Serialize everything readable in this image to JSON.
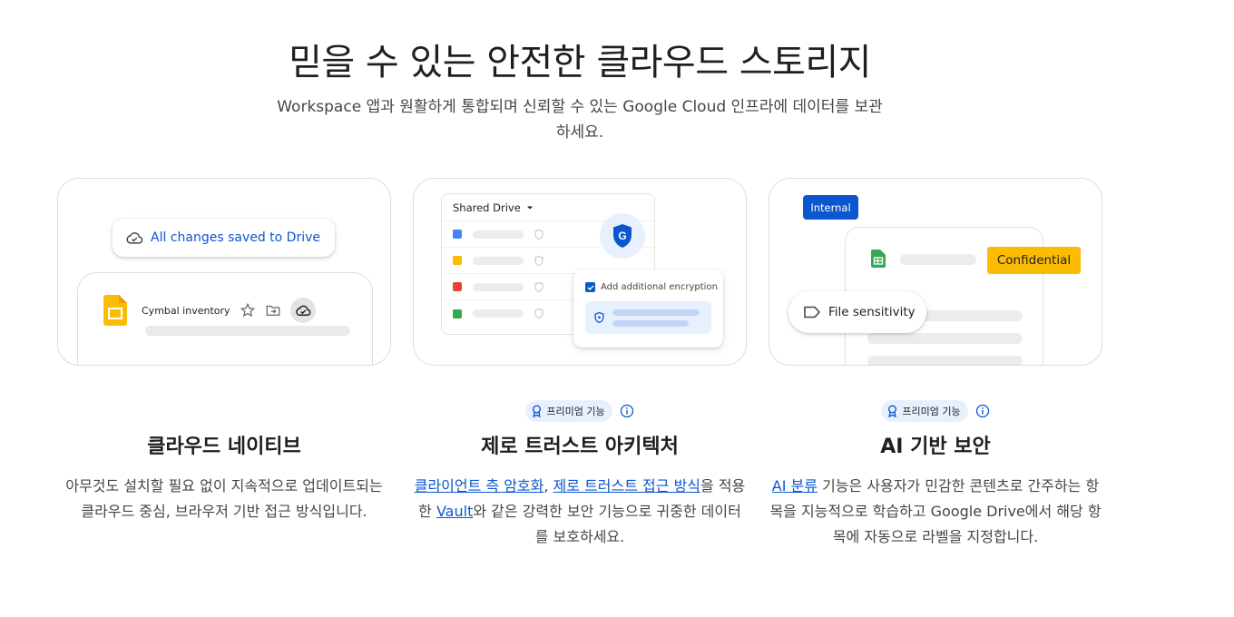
{
  "hero": {
    "title": "믿을 수 있는 안전한 클라우드 스토리지",
    "subtitle": "Workspace 앱과 원활하게 통합되며 신뢰할 수 있는 Google Cloud 인프라에 데이터를 보관하세요."
  },
  "cards": {
    "card1": {
      "save_status": "All changes saved to Drive",
      "doc_name": "Cymbal inventory"
    },
    "card2": {
      "drive_name": "Shared Drive",
      "encryption_option": "Add additional encryption",
      "file_types": [
        "docs",
        "slides",
        "pdf",
        "sheets"
      ],
      "encryption_checked": true
    },
    "card3": {
      "tag_internal": "Internal",
      "tag_confidential": "Confidential",
      "file_sensitivity": "File sensitivity"
    }
  },
  "features": [
    {
      "premium_badge": "",
      "title": "클라우드 네이티브",
      "desc": "아무것도 설치할 필요 없이 지속적으로 업데이트되는 클라우드 중심, 브라우저 기반 접근 방식입니다."
    },
    {
      "premium_badge": "프리미엄 기능",
      "title": "제로 트러스트 아키텍처",
      "link1": "클라이언트 측 암호화",
      "sep1": ", ",
      "link2": "제로 트러스트 접근 방식",
      "text1": "을 적용한 ",
      "link3": "Vault",
      "text2": "와 같은 강력한 보안 기능으로 귀중한 데이터를 보호하세요."
    },
    {
      "premium_badge": "프리미엄 기능",
      "title": "AI 기반 보안",
      "link1": "AI 분류",
      "text1": " 기능은 사용자가 민감한 콘텐츠로 간주하는 항목을 지능적으로 학습하고 Google Drive에서 해당 항목에 자동으로 라벨을 지정합니다."
    }
  ],
  "colors": {
    "accent": "#0b57d0",
    "badge_bg": "#e8f0fe",
    "confidential": "#fbbc04",
    "docs": "#4285f4",
    "slides": "#fbbc04",
    "pdf": "#ea4335",
    "sheets": "#34a853"
  }
}
